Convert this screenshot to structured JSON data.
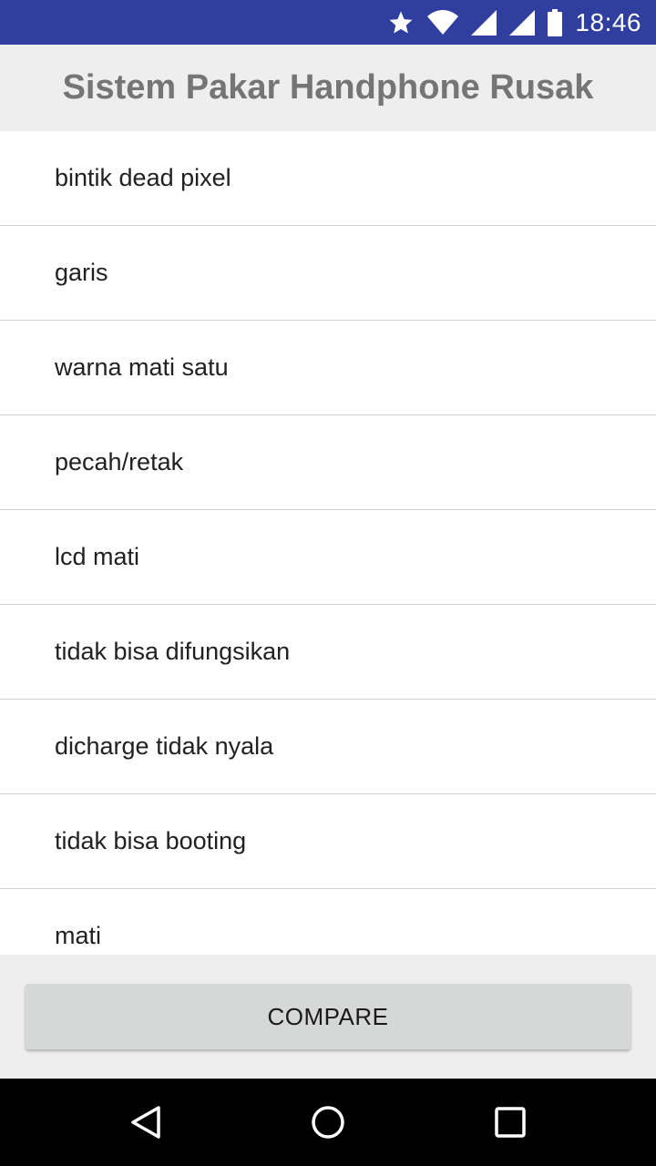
{
  "status_bar": {
    "time": "18:46",
    "icons": [
      "star-icon",
      "wifi-icon",
      "signal-icon",
      "signal-icon",
      "battery-icon"
    ]
  },
  "app": {
    "title": "Sistem Pakar Handphone Rusak"
  },
  "list": {
    "items": [
      "bintik dead pixel",
      "garis",
      "warna mati satu",
      "pecah/retak",
      "lcd mati",
      "tidak bisa difungsikan",
      "dicharge tidak nyala",
      "tidak bisa booting",
      "mati"
    ]
  },
  "actions": {
    "compare_label": "COMPARE"
  },
  "nav_bar": {
    "icons": [
      "back-icon",
      "home-icon",
      "recents-icon"
    ]
  },
  "colors": {
    "status_bar": "#303f9f",
    "header_bg": "#eeeeee",
    "title_text": "#757575",
    "button_bg": "#d6d7d7"
  }
}
